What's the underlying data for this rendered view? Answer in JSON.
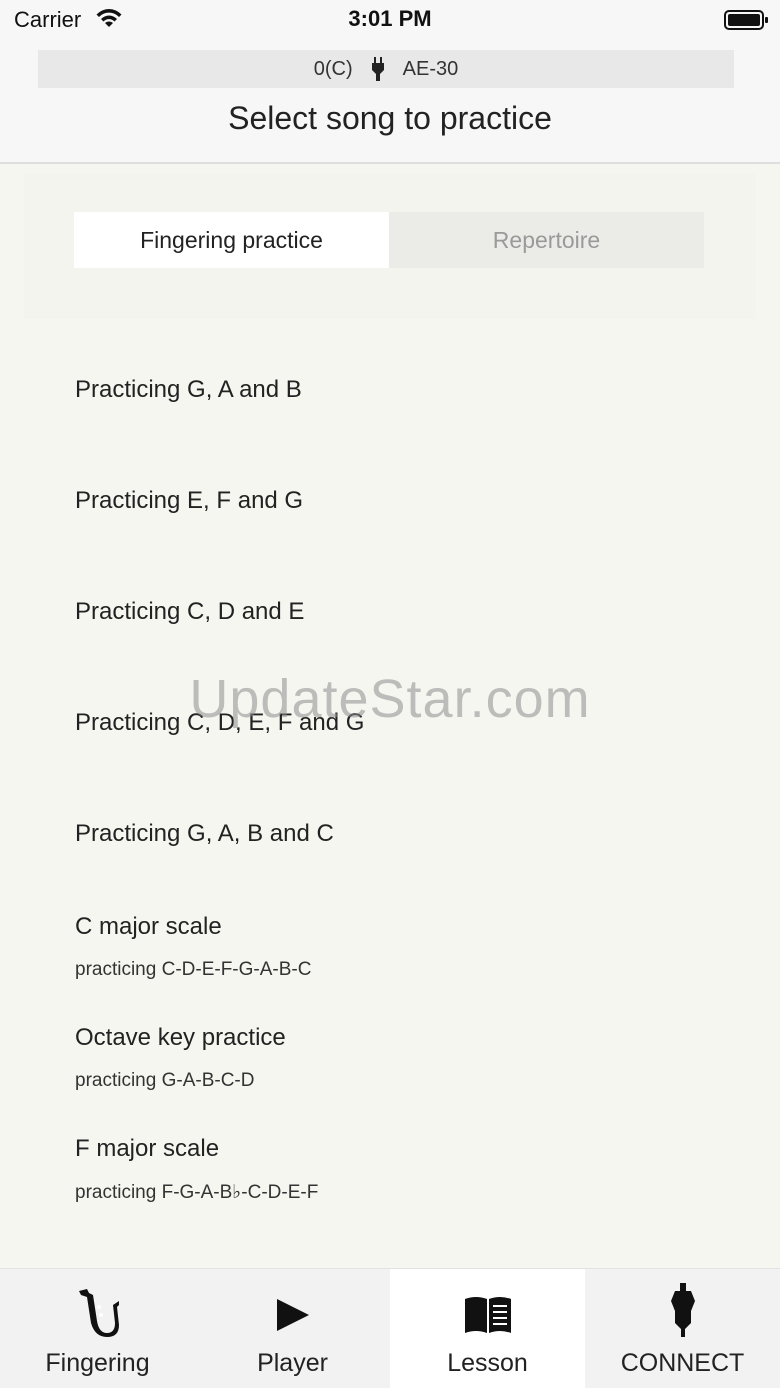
{
  "status_bar": {
    "carrier": "Carrier",
    "time": "3:01 PM"
  },
  "header": {
    "device_key": "0(C)",
    "device_name": "AE-30",
    "title": "Select song to practice"
  },
  "segments": {
    "fingering": "Fingering practice",
    "repertoire": "Repertoire"
  },
  "songs": [
    {
      "title": "Practicing G, A and B",
      "subtitle": ""
    },
    {
      "title": "Practicing E, F and G",
      "subtitle": ""
    },
    {
      "title": "Practicing C, D and E",
      "subtitle": ""
    },
    {
      "title": "Practicing C, D, E, F and G",
      "subtitle": ""
    },
    {
      "title": "Practicing G, A, B and C",
      "subtitle": ""
    },
    {
      "title": "C major scale",
      "subtitle": "practicing C-D-E-F-G-A-B-C"
    },
    {
      "title": "Octave key practice",
      "subtitle": "practicing G-A-B-C-D"
    },
    {
      "title": "F major scale",
      "subtitle": "practicing F-G-A-B♭-C-D-E-F"
    }
  ],
  "watermark": "UpdateStar.com",
  "tabs": [
    {
      "label": "Fingering",
      "icon": "saxophone-icon"
    },
    {
      "label": "Player",
      "icon": "play-icon"
    },
    {
      "label": "Lesson",
      "icon": "book-icon"
    },
    {
      "label": "CONNECT",
      "icon": "plug-icon"
    }
  ],
  "colors": {
    "background": "#f6f6f1",
    "active_segment": "#ffffff",
    "inactive_segment_text": "#9a9a9a"
  }
}
